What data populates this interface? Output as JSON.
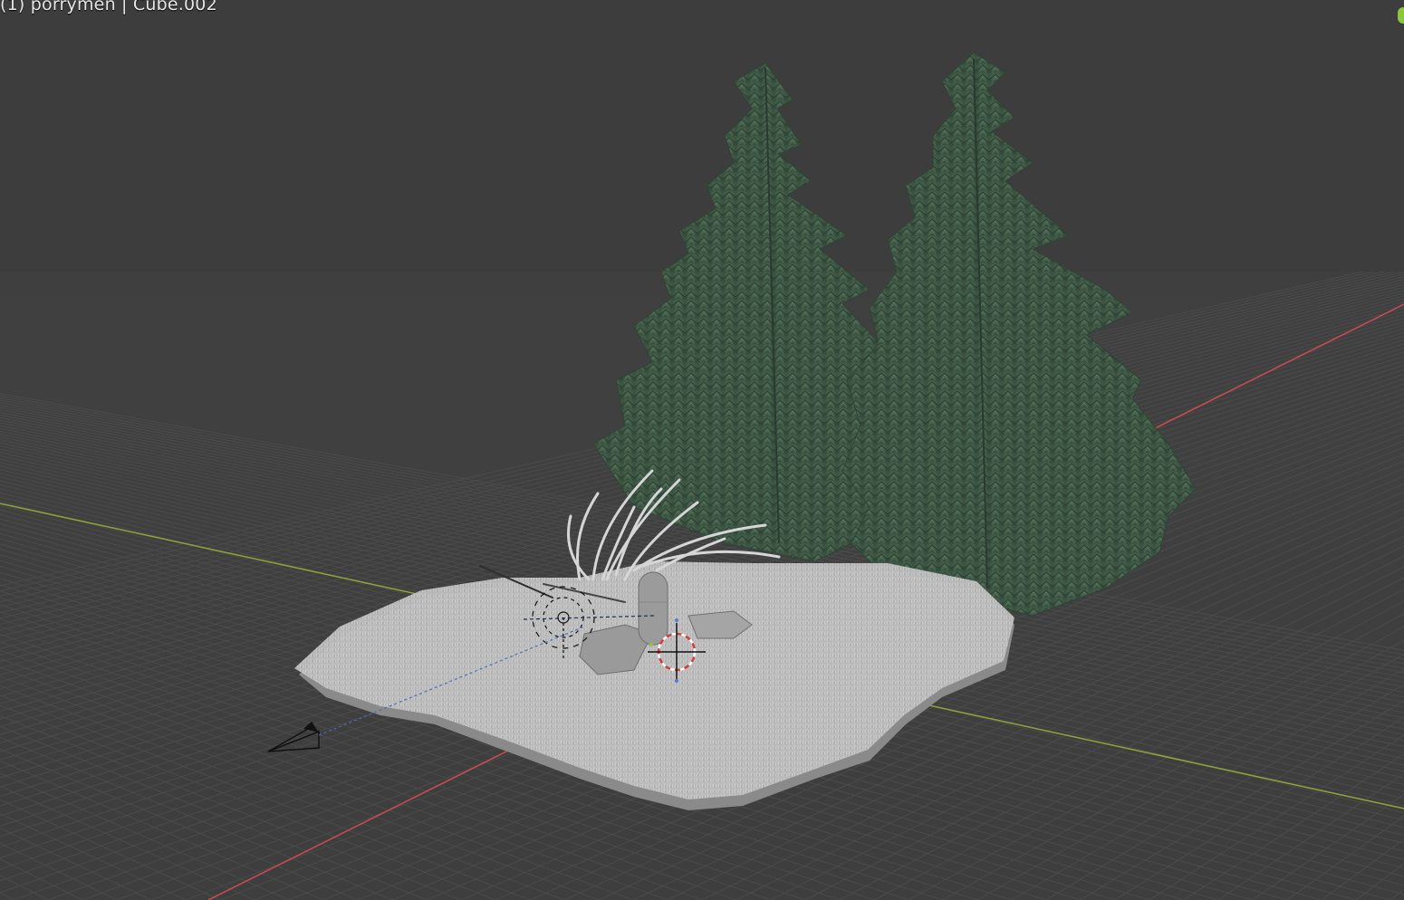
{
  "viewport": {
    "title": "(1) porrymen  | Cube.002",
    "background_color": "#3d3d3d",
    "grid_color": "#4d4d4d",
    "x_axis_color": "#c44c52",
    "y_axis_color": "#8aa13a",
    "ground_color": "#b5b5b5",
    "tree_color": "#3f5a44",
    "grass_color": "#cfcfcf"
  },
  "scene": {
    "objects": [
      {
        "name": "ground-terrain",
        "icon": "terrain"
      },
      {
        "name": "spruce-tree-left",
        "icon": "tree"
      },
      {
        "name": "spruce-tree-right",
        "icon": "tree"
      },
      {
        "name": "grass-tuft",
        "icon": "grass"
      },
      {
        "name": "capsule",
        "icon": "capsule"
      },
      {
        "name": "camera",
        "icon": "camera-icon"
      },
      {
        "name": "light",
        "icon": "light-icon"
      },
      {
        "name": "3d-cursor",
        "icon": "cursor-icon"
      }
    ]
  },
  "nav_gizmo": {
    "color": "#8cc63f"
  }
}
